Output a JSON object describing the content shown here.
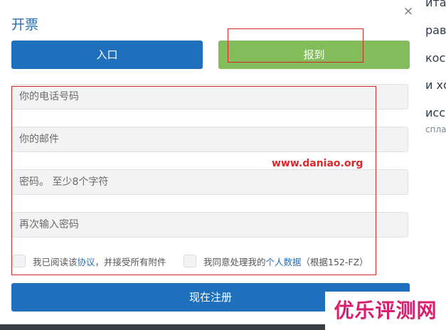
{
  "background": {
    "lines": [
      "ита",
      "рав",
      "кост",
      "и хо",
      "исса",
      "спла"
    ]
  },
  "modal": {
    "title": "开票",
    "close_symbol": "×",
    "tabs": {
      "login_label": "入口",
      "register_label": "报到"
    },
    "fields": {
      "phone_placeholder": "你的电话号码",
      "email_placeholder": "你的邮件",
      "password_placeholder": "密码。 至少8个字符",
      "password_repeat_placeholder": "再次输入密码"
    },
    "agreements": {
      "terms_prefix": "我已阅读该",
      "terms_link": "协议",
      "terms_suffix": "，并接受所有附件",
      "privacy_prefix": "我同意处理我的",
      "privacy_link": "个人数据",
      "privacy_suffix": "（根据152-FZ）"
    },
    "submit_label": "现在注册"
  },
  "watermarks": {
    "url": "www.daniao.org",
    "brand": "优乐评测网"
  },
  "colors": {
    "primary": "#1f70bc",
    "success": "#83bd5b",
    "annotation": "#d9252a",
    "brand": "#d81f6f"
  }
}
